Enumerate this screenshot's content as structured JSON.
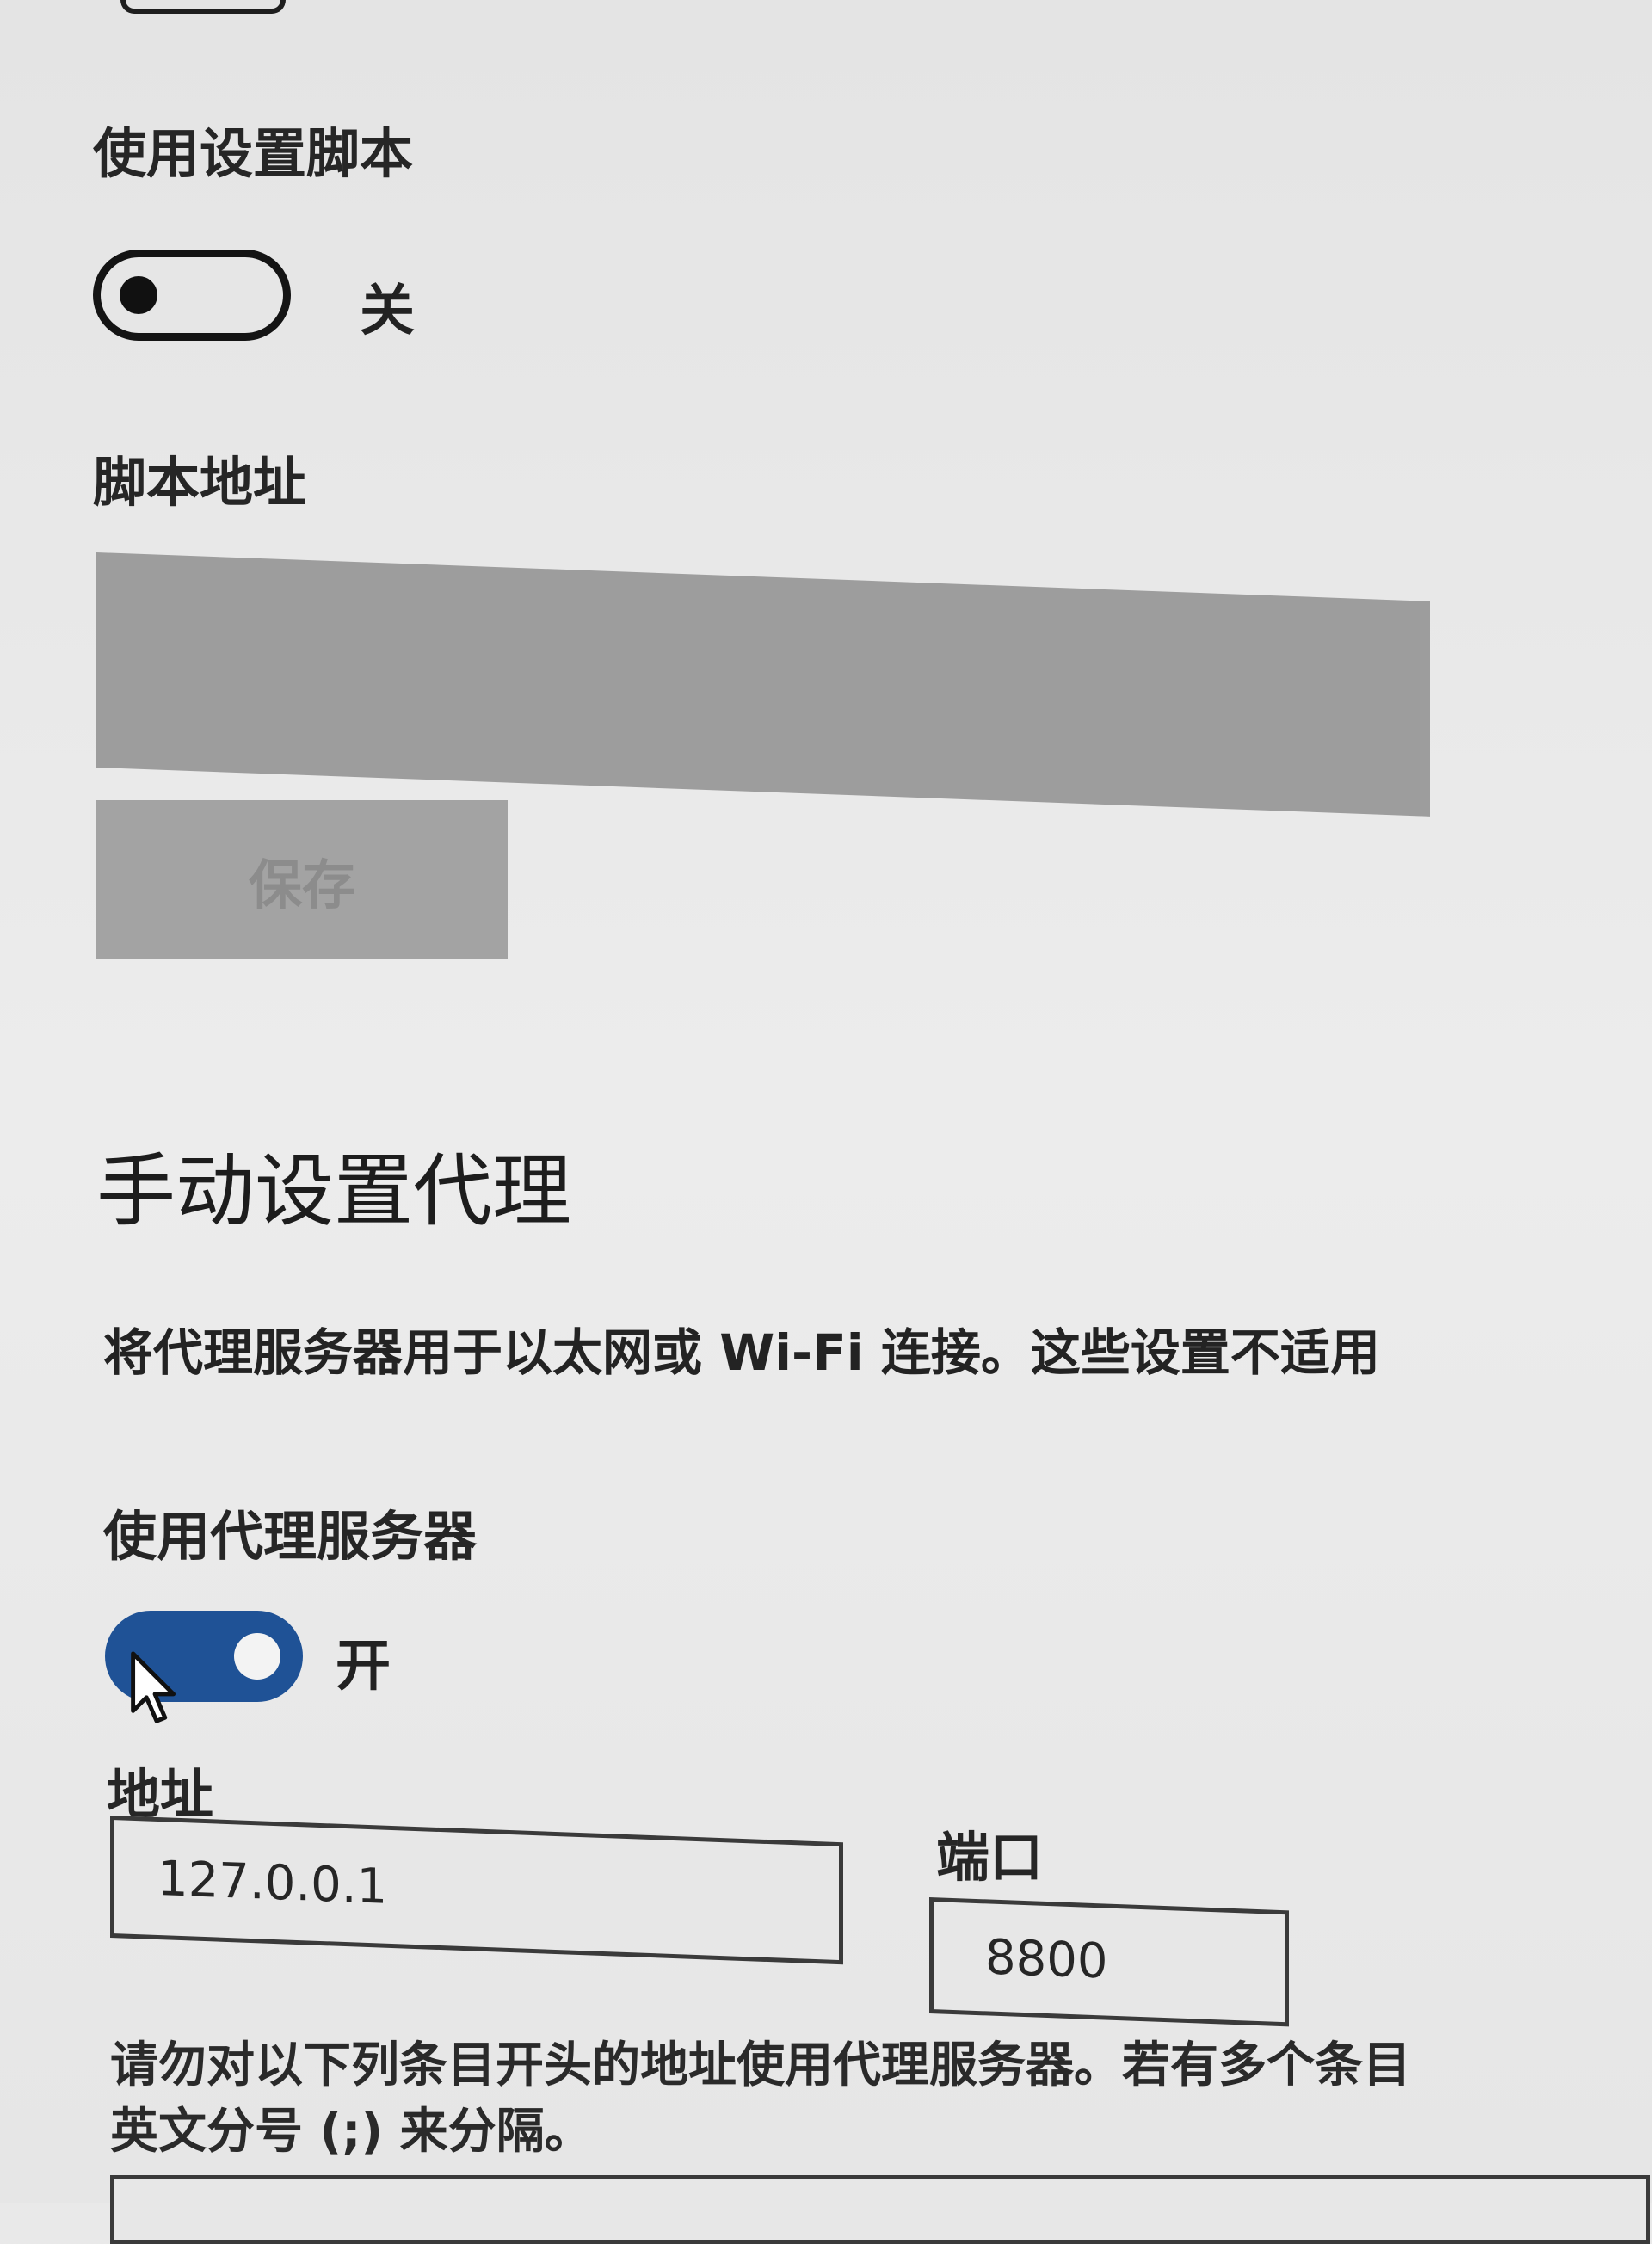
{
  "script_section": {
    "toggle_label": "使用设置脚本",
    "toggle_state_text": "关",
    "toggle_on": false,
    "address_label": "脚本地址",
    "address_value": "",
    "save_label": "保存"
  },
  "manual_proxy": {
    "title": "手动设置代理",
    "description": "将代理服务器用于以太网或 Wi-Fi 连接。这些设置不适用",
    "use_proxy_label": "使用代理服务器",
    "use_proxy_state_text": "开",
    "use_proxy_on": true,
    "address_label": "地址",
    "address_value": "127.0.0.1",
    "port_label": "端口",
    "port_value": "8800",
    "exceptions_note_line1": "请勿对以下列条目开头的地址使用代理服务器。若有多个条目",
    "exceptions_note_line2": "英文分号 (;) 来分隔。"
  },
  "colors": {
    "toggle_on": "#1f5296",
    "disabled_input": "#9d9d9d",
    "disabled_button": "#a3a3a3",
    "background": "#e9e9e9"
  },
  "icons": {
    "cursor": "arrow-cursor-icon"
  }
}
